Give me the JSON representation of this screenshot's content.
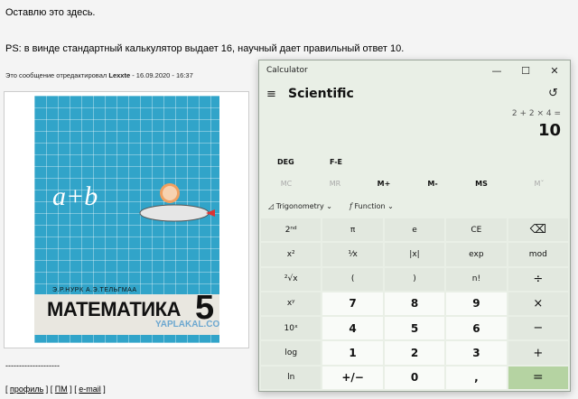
{
  "post": {
    "line1": "Оставлю это здесь.",
    "line2": "PS: в винде стандартный калькулятор выдает 16, научный дает правильный ответ 10.",
    "edit_note_prefix": "Это сообщение отредактировал",
    "edit_note_user": "Lexxte",
    "edit_note_suffix": "- 16.09.2020 - 16:37",
    "signature": "--------------------",
    "links": {
      "profile": "профиль",
      "pm": "ПМ",
      "email": "e-mail"
    }
  },
  "book": {
    "formula": "a+b",
    "authors": "Э.Р.НУРК  А.Э.ТЕЛЬГМАА",
    "title": "МАТЕМАТИКА",
    "grade": "5",
    "watermark": "YAPLAKAL.COM"
  },
  "calculator": {
    "window_title": "Calculator",
    "window_controls": {
      "minimize": "—",
      "maximize": "☐",
      "close": "✕"
    },
    "menu_icon": "≡",
    "mode": "Scientific",
    "history_icon": "↺",
    "expression": "2 + 2 × 4 =",
    "result": "10",
    "angle_mode": "DEG",
    "fe": "F-E",
    "memory": [
      "MC",
      "MR",
      "M+",
      "M-",
      "MS",
      "Mˇ"
    ],
    "dropdowns": {
      "trig": "Trigonometry",
      "func": "Function"
    },
    "keys": [
      [
        "2ⁿᵈ",
        "π",
        "e",
        "CE",
        "⌫"
      ],
      [
        "x²",
        "¹⁄x",
        "|x|",
        "exp",
        "mod"
      ],
      [
        "²√x",
        "(",
        ")",
        "n!",
        "÷"
      ],
      [
        "xʸ",
        "7",
        "8",
        "9",
        "×"
      ],
      [
        "10ˣ",
        "4",
        "5",
        "6",
        "−"
      ],
      [
        "log",
        "1",
        "2",
        "3",
        "+"
      ],
      [
        "ln",
        "+/−",
        "0",
        ",",
        "="
      ]
    ]
  },
  "colors": {
    "accent": "#b5d3a2",
    "calc_bg": "#e9efe6",
    "book_blue": "#31a4c9"
  }
}
